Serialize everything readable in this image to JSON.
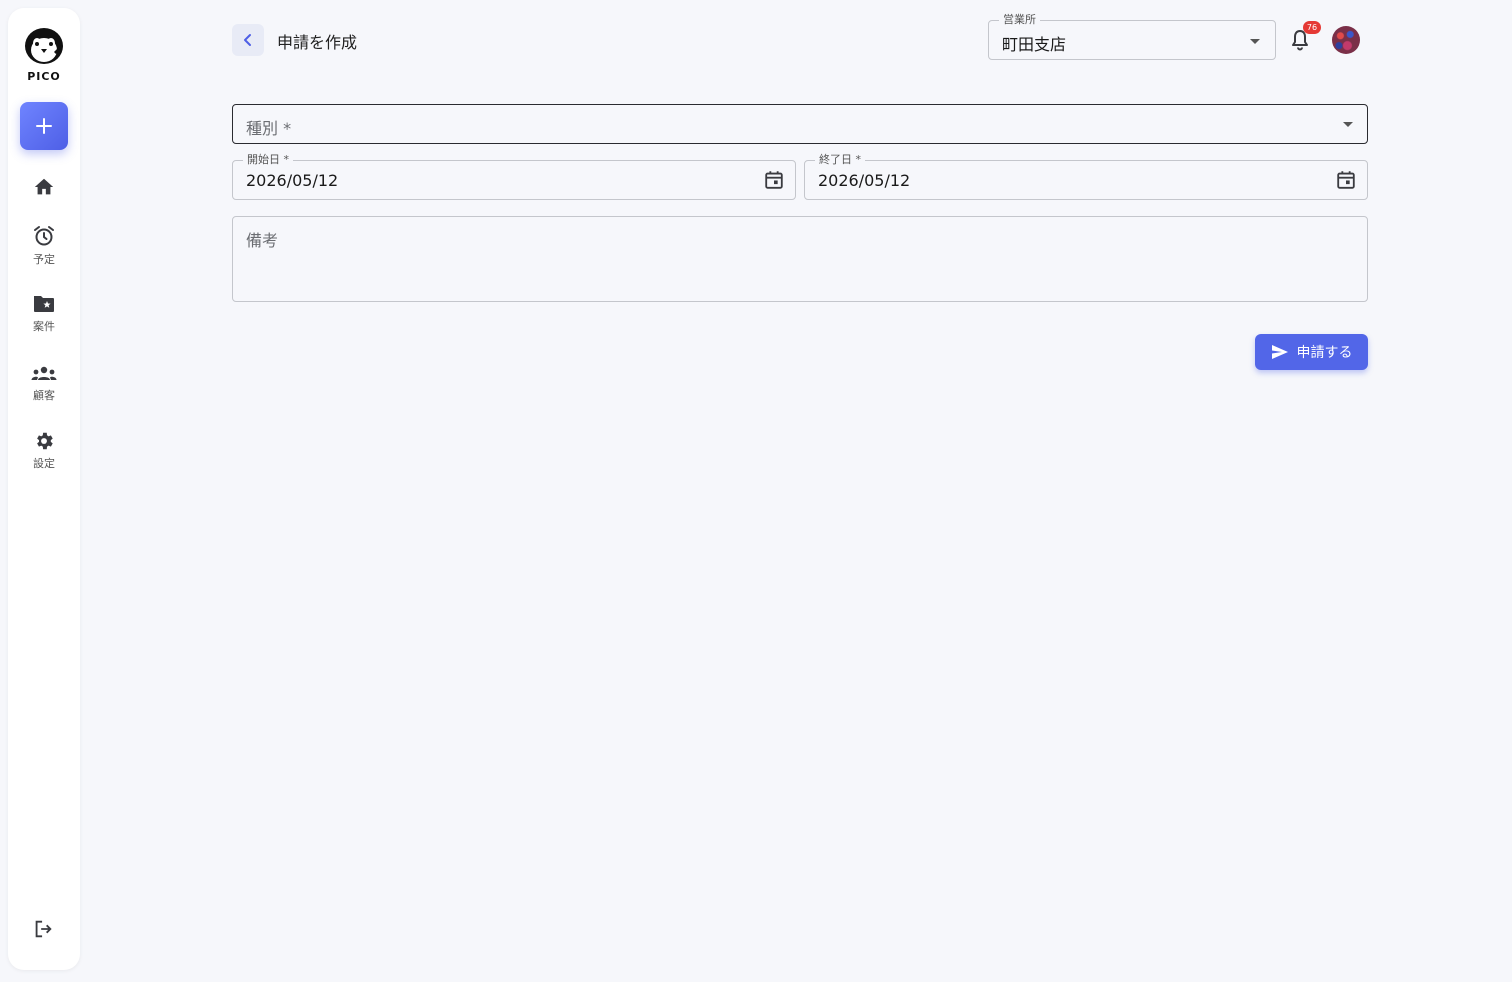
{
  "sidebar": {
    "logo_text": "PICO",
    "add_icon": "plus-icon",
    "items": [
      {
        "icon": "home-icon",
        "label": ""
      },
      {
        "icon": "alarm-clock-icon",
        "label": "予定"
      },
      {
        "icon": "folder-star-icon",
        "label": "案件"
      },
      {
        "icon": "groups-icon",
        "label": "顧客"
      },
      {
        "icon": "gear-icon",
        "label": "設定"
      }
    ],
    "logout_icon": "logout-icon"
  },
  "header": {
    "back_icon": "chevron-left-icon",
    "title": "申請を作成",
    "office": {
      "label": "営業所",
      "value": "町田支店"
    },
    "notification_count": "76"
  },
  "form": {
    "type_placeholder": "種別 *",
    "start_date": {
      "label": "開始日 *",
      "value": "2026/05/12"
    },
    "end_date": {
      "label": "終了日 *",
      "value": "2026/05/12"
    },
    "notes_placeholder": "備考",
    "submit_label": "申請する"
  },
  "colors": {
    "accent": "#5266e8",
    "badge": "#e53935",
    "background": "#f6f7fb"
  }
}
